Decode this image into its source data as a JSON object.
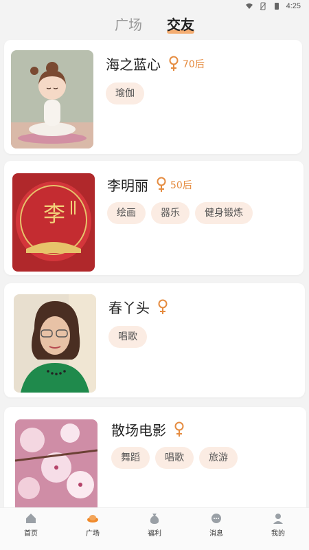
{
  "status": {
    "time": "4:25"
  },
  "tabs": [
    {
      "label": "广场",
      "active": false
    },
    {
      "label": "交友",
      "active": true
    }
  ],
  "profiles": [
    {
      "name": "海之蓝心",
      "gender": "female",
      "age": "70后",
      "tags": [
        "瑜伽"
      ],
      "photo": "cartoon-yoga-girl"
    },
    {
      "name": "李明丽",
      "gender": "female",
      "age": "50后",
      "tags": [
        "绘画",
        "器乐",
        "健身锻炼"
      ],
      "photo": "red-li-emblem"
    },
    {
      "name": "春丫头",
      "gender": "female",
      "age": "",
      "tags": [
        "唱歌"
      ],
      "photo": "woman-portrait"
    },
    {
      "name": "散场电影",
      "gender": "female",
      "age": "",
      "tags": [
        "舞蹈",
        "唱歌",
        "旅游"
      ],
      "photo": "cherry-blossoms"
    }
  ],
  "bottom_nav": [
    {
      "label": "首页",
      "icon": "home-icon"
    },
    {
      "label": "广场",
      "icon": "plaza-icon",
      "active": true
    },
    {
      "label": "福利",
      "icon": "money-bag-icon"
    },
    {
      "label": "消息",
      "icon": "message-icon"
    },
    {
      "label": "我的",
      "icon": "person-icon"
    }
  ],
  "colors": {
    "accent": "#e58b3f",
    "tag_bg": "#fbece3",
    "gender": "#e58b3f"
  }
}
